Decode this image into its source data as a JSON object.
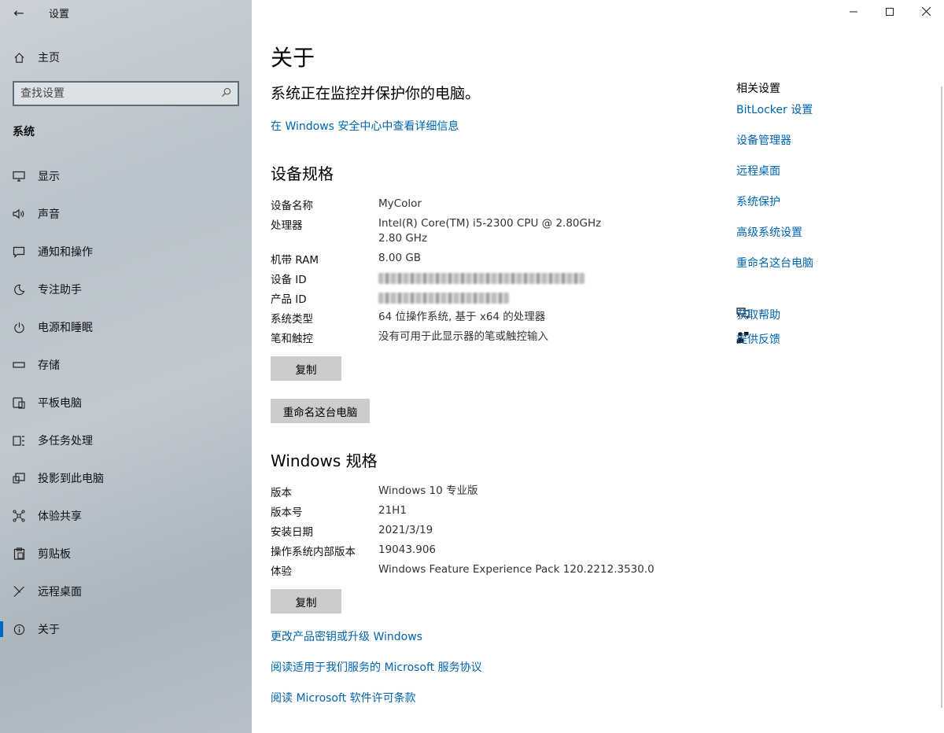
{
  "app": {
    "title": "设置"
  },
  "window_controls": {
    "minimize": "—",
    "maximize": "☐",
    "close": "✕"
  },
  "sidebar": {
    "home_label": "主页",
    "search_placeholder": "查找设置",
    "section_label": "系统",
    "items": [
      {
        "label": "显示",
        "icon": "monitor-icon"
      },
      {
        "label": "声音",
        "icon": "speaker-icon"
      },
      {
        "label": "通知和操作",
        "icon": "notification-icon"
      },
      {
        "label": "专注助手",
        "icon": "moon-icon"
      },
      {
        "label": "电源和睡眠",
        "icon": "power-icon"
      },
      {
        "label": "存储",
        "icon": "storage-icon"
      },
      {
        "label": "平板电脑",
        "icon": "tablet-icon"
      },
      {
        "label": "多任务处理",
        "icon": "multitask-icon"
      },
      {
        "label": "投影到此电脑",
        "icon": "project-icon"
      },
      {
        "label": "体验共享",
        "icon": "share-icon"
      },
      {
        "label": "剪贴板",
        "icon": "clipboard-icon"
      },
      {
        "label": "远程桌面",
        "icon": "remote-icon"
      },
      {
        "label": "关于",
        "icon": "info-icon",
        "active": true
      }
    ]
  },
  "main": {
    "title": "关于",
    "protection_text": "系统正在监控并保护你的电脑。",
    "security_link": "在 Windows 安全中心中查看详细信息",
    "device_specs": {
      "heading": "设备规格",
      "rows": [
        {
          "key": "设备名称",
          "value": "MyColor"
        },
        {
          "key": "处理器",
          "value": "Intel(R) Core(TM) i5-2300 CPU @ 2.80GHz   2.80 GHz"
        },
        {
          "key": "机带 RAM",
          "value": "8.00 GB"
        },
        {
          "key": "设备 ID",
          "value": ""
        },
        {
          "key": "产品 ID",
          "value": ""
        },
        {
          "key": "系统类型",
          "value": "64 位操作系统, 基于 x64 的处理器"
        },
        {
          "key": "笔和触控",
          "value": "没有可用于此显示器的笔或触控输入"
        }
      ],
      "copy_button": "复制",
      "rename_button": "重命名这台电脑"
    },
    "windows_specs": {
      "heading": "Windows 规格",
      "rows": [
        {
          "key": "版本",
          "value": "Windows 10 专业版"
        },
        {
          "key": "版本号",
          "value": "21H1"
        },
        {
          "key": "安装日期",
          "value": "2021/3/19"
        },
        {
          "key": "操作系统内部版本",
          "value": "19043.906"
        },
        {
          "key": "体验",
          "value": "Windows Feature Experience Pack 120.2212.3530.0"
        }
      ],
      "copy_button": "复制"
    },
    "bottom_links": [
      "更改产品密钥或升级 Windows",
      "阅读适用于我们服务的 Microsoft 服务协议",
      "阅读 Microsoft 软件许可条款"
    ]
  },
  "related": {
    "title": "相关设置",
    "links": [
      "BitLocker 设置",
      "设备管理器",
      "远程桌面",
      "系统保护",
      "高级系统设置",
      "重命名这台电脑"
    ],
    "help": [
      {
        "label": "获取帮助",
        "icon": "help-chat-icon"
      },
      {
        "label": "提供反馈",
        "icon": "feedback-icon"
      }
    ]
  },
  "colors": {
    "accent": "#0067c0",
    "link": "#0063b1",
    "button": "#cccccc"
  }
}
